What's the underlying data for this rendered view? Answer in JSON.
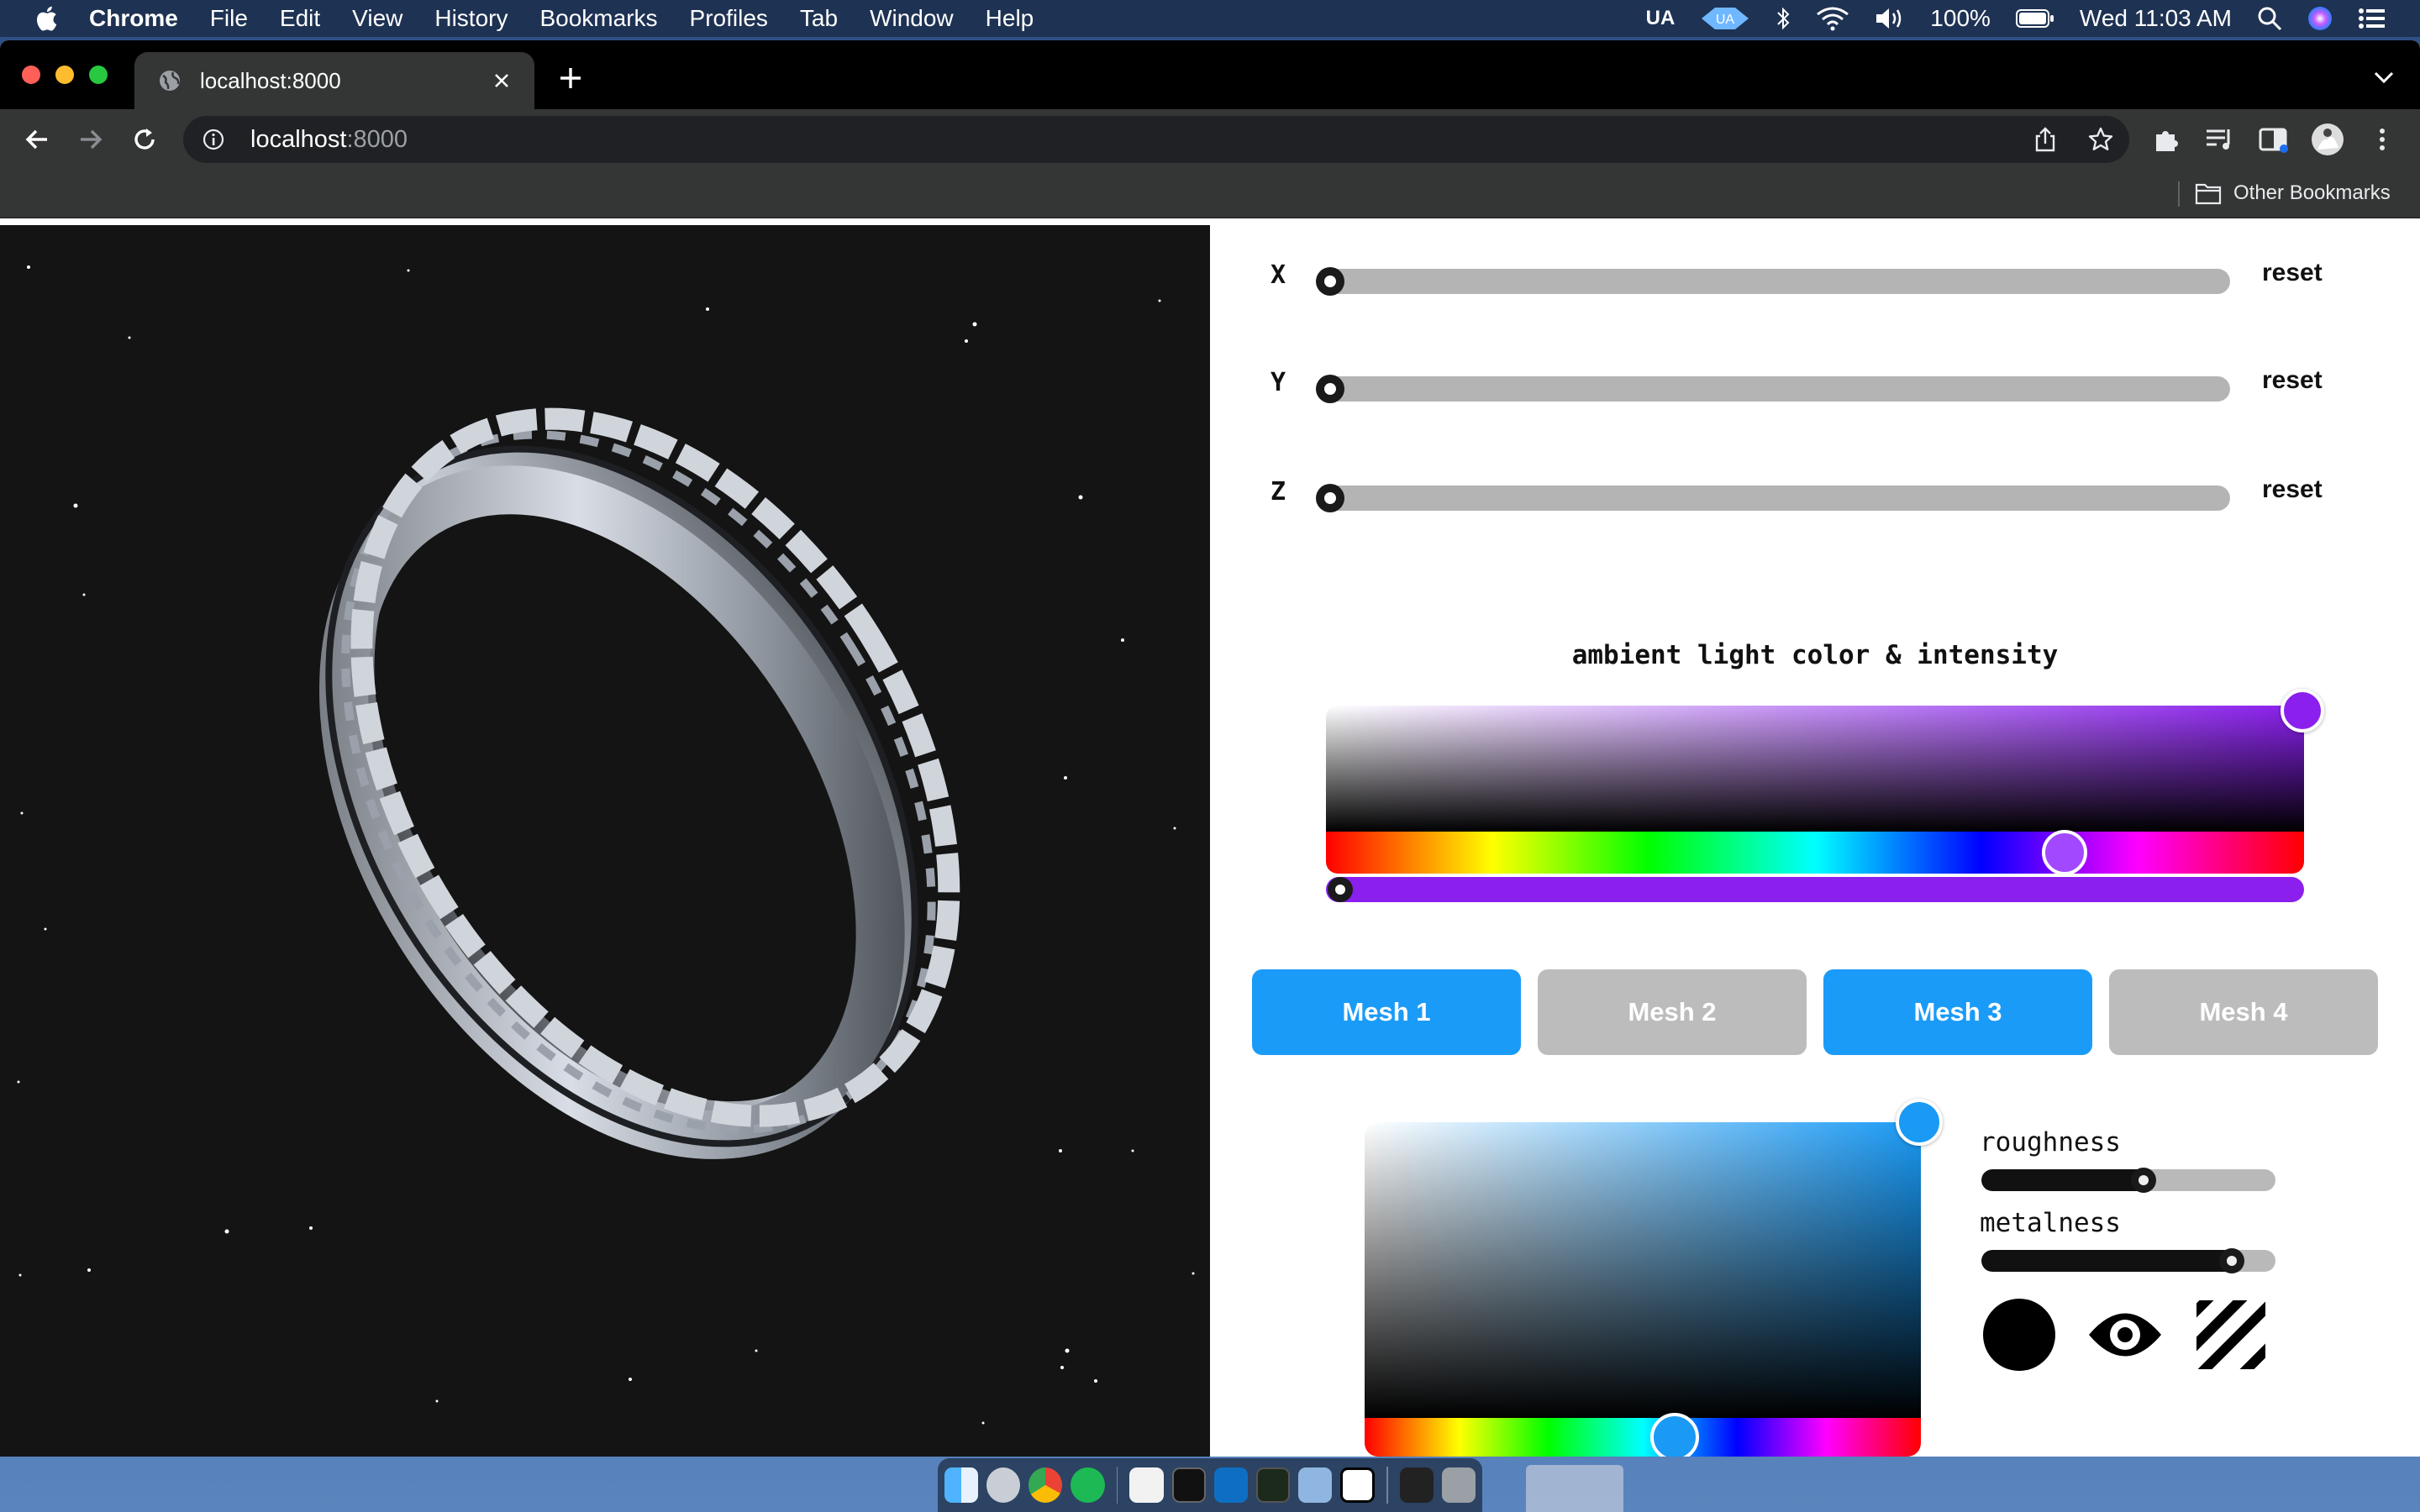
{
  "menubar": {
    "items": [
      "Chrome",
      "File",
      "Edit",
      "View",
      "History",
      "Bookmarks",
      "Profiles",
      "Tab",
      "Window",
      "Help"
    ],
    "status": {
      "keyboard": "UA",
      "battery": "100%",
      "clock": "Wed 11:03 AM"
    }
  },
  "browser": {
    "tab_title": "localhost:8000",
    "url_host": "localhost",
    "url_port": ":8000",
    "other_bookmarks": "Other Bookmarks"
  },
  "panel": {
    "axes": [
      {
        "label": "X",
        "value": 0,
        "reset": "reset"
      },
      {
        "label": "Y",
        "value": 0,
        "reset": "reset"
      },
      {
        "label": "Z",
        "value": 0,
        "reset": "reset"
      }
    ],
    "ambient_title": "ambient light color & intensity",
    "ambient_color": "#8a1fee",
    "ambient_hue_position": 0.76,
    "ambient_intensity": 0.0,
    "mesh_buttons": [
      {
        "label": "Mesh 1",
        "active": true
      },
      {
        "label": "Mesh 2",
        "active": false
      },
      {
        "label": "Mesh 3",
        "active": true
      },
      {
        "label": "Mesh 4",
        "active": false
      }
    ],
    "material_color": "#1a9af5",
    "material_hue_position": 0.56,
    "roughness": {
      "label": "roughness",
      "value": 0.55
    },
    "metalness": {
      "label": "metalness",
      "value": 0.85
    },
    "tools": [
      "circle-icon",
      "eye-icon",
      "stripes-icon"
    ]
  },
  "colors": {
    "accent_blue": "#1b9bf8",
    "inactive_gray": "#bcbcbc",
    "viewer_bg": "#141414"
  }
}
